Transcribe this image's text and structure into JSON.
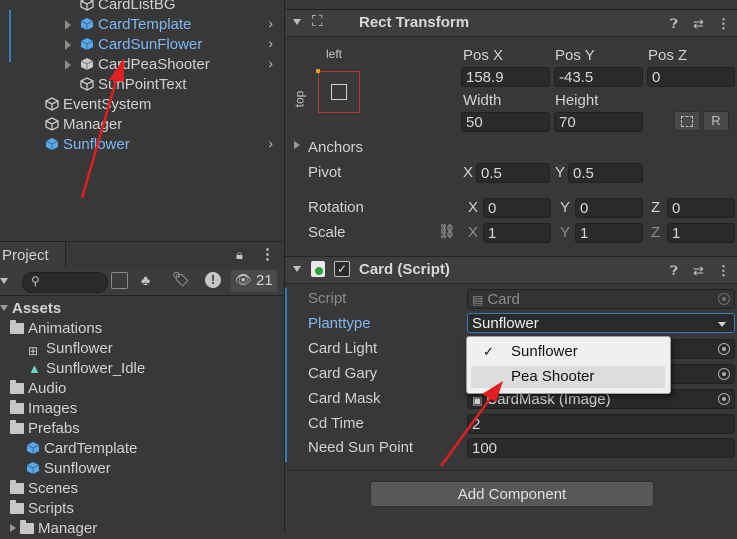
{
  "hierarchy": {
    "items": [
      {
        "label": "CardListBG"
      },
      {
        "label": "CardTemplate"
      },
      {
        "label": "CardSunFlower"
      },
      {
        "label": "CardPeaShooter"
      },
      {
        "label": "SunPointText"
      },
      {
        "label": "EventSystem"
      },
      {
        "label": "Manager"
      },
      {
        "label": "Sunflower"
      }
    ]
  },
  "project": {
    "tab_label": "Project",
    "hidden_count": "21",
    "tree": [
      {
        "label": "Assets"
      },
      {
        "label": "Animations"
      },
      {
        "label": "Sunflower"
      },
      {
        "label": "Sunflower_Idle"
      },
      {
        "label": "Audio"
      },
      {
        "label": "Images"
      },
      {
        "label": "Prefabs"
      },
      {
        "label": "CardTemplate"
      },
      {
        "label": "Sunflower"
      },
      {
        "label": "Scenes"
      },
      {
        "label": "Scripts"
      },
      {
        "label": "Manager"
      }
    ]
  },
  "inspector": {
    "rect_transform": {
      "title": "Rect Transform",
      "anchor_preset_left": "left",
      "anchor_preset_top": "top",
      "pos_x_label": "Pos X",
      "pos_x": "158.9",
      "pos_y_label": "Pos Y",
      "pos_y": "-43.5",
      "pos_z_label": "Pos Z",
      "pos_z": "0",
      "width_label": "Width",
      "width": "50",
      "height_label": "Height",
      "height": "70",
      "raw_edit_label": "R",
      "anchors_label": "Anchors",
      "pivot_label": "Pivot",
      "pivot_x_label": "X",
      "pivot_x": "0.5",
      "pivot_y_label": "Y",
      "pivot_y": "0.5",
      "rotation_label": "Rotation",
      "rot_x_label": "X",
      "rot_x": "0",
      "rot_y_label": "Y",
      "rot_y": "0",
      "rot_z_label": "Z",
      "rot_z": "0",
      "scale_label": "Scale",
      "scale_x_label": "X",
      "scale_x": "1",
      "scale_y_label": "Y",
      "scale_y": "1",
      "scale_z_label": "Z",
      "scale_z": "1"
    },
    "card_script": {
      "title": "Card (Script)",
      "script_label": "Script",
      "script_value": "Card",
      "planttype_label": "Planttype",
      "planttype_value": "Sunflower",
      "card_light_label": "Card Light",
      "card_gary_label": "Card Gary",
      "card_mask_label": "Card Mask",
      "card_mask_value": "CardMask (Image)",
      "cd_time_label": "Cd Time",
      "cd_time_value": "2",
      "need_sun_label": "Need Sun Point",
      "need_sun_value": "100"
    },
    "dropdown": {
      "options": [
        {
          "label": "Sunflower",
          "checked": "✓"
        },
        {
          "label": "Pea Shooter",
          "checked": ""
        }
      ]
    },
    "add_component_label": "Add Component"
  },
  "colors": {
    "accent": "#80b6f2",
    "selection": "#3a79bb",
    "arrow": "#e02020"
  }
}
